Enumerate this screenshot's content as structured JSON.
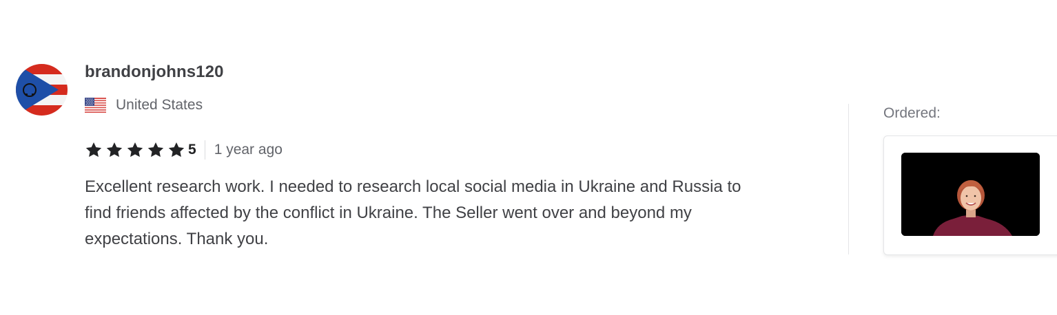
{
  "review": {
    "user": {
      "username": "brandonjohns120",
      "avatar_icon": "puerto-rico-flag-avatar",
      "country": "United States",
      "country_flag_icon": "us-flag-icon"
    },
    "rating": {
      "stars": 5,
      "value": "5",
      "star_color": "#222325"
    },
    "time_ago": "1 year ago",
    "text": "Excellent research work. I needed to research local social media in Ukraine and Russia to find friends affected by the conflict in Ukraine. The Seller went over and beyond my expectations. Thank you.",
    "ordered": {
      "label": "Ordered:",
      "thumbnail_icon": "gig-thumbnail-image"
    }
  },
  "colors": {
    "text_primary": "#404145",
    "text_secondary": "#62646a",
    "divider": "#e4e5e7"
  }
}
